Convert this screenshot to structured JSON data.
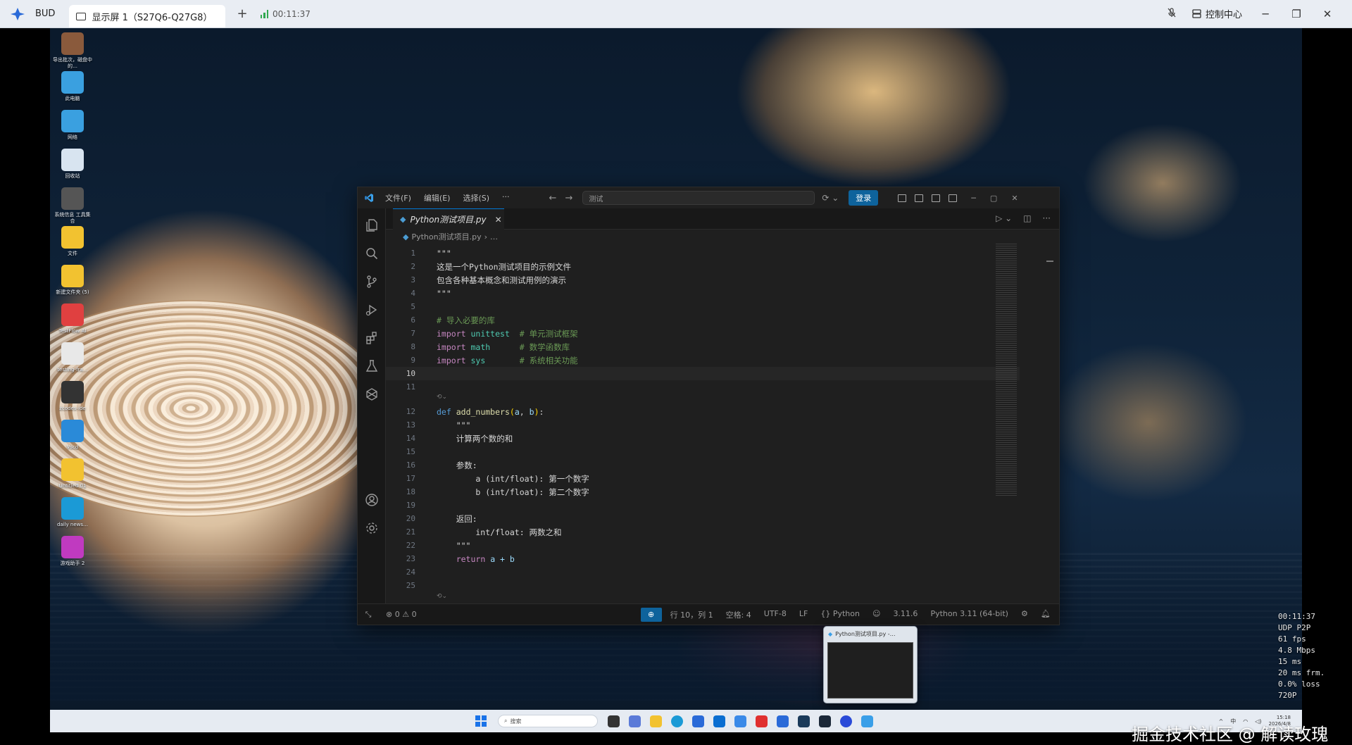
{
  "client": {
    "app_name": "BUD",
    "tab_title": "显示屏 1（S27Q6-Q27G8）",
    "timer": "00:11:37",
    "control_center": "控制中心"
  },
  "desktop_icons": [
    {
      "label": "导出批次，磁盘中的…",
      "color": "#8a5a3c"
    },
    {
      "label": "此电脑",
      "color": "#3aa0e0"
    },
    {
      "label": "网络",
      "color": "#3aa0e0"
    },
    {
      "label": "回收站",
      "color": "#d8e4f0"
    },
    {
      "label": "系统信息 工具集合",
      "color": "#555555"
    },
    {
      "label": "文件",
      "color": "#f2c230"
    },
    {
      "label": "新建文件夹 (5)",
      "color": "#f2c230"
    },
    {
      "label": "TestFlow AI",
      "color": "#e04040"
    },
    {
      "label": "testing-fra…",
      "color": "#e8e8e8"
    },
    {
      "label": "zcodes-ide",
      "color": "#333333"
    },
    {
      "label": "Vscd",
      "color": "#2a8ad8"
    },
    {
      "label": "Untitled 01",
      "color": "#f2c230"
    },
    {
      "label": "daily news…",
      "color": "#1b9ad6"
    },
    {
      "label": "游戏助手 2",
      "color": "#c03ac0"
    }
  ],
  "vscode": {
    "menu": [
      "文件(F)",
      "编辑(E)",
      "选择(S)",
      "···"
    ],
    "command_center": "测试",
    "login_label": "登录",
    "tab_label": "Python测试项目.py",
    "breadcrumb": "Python测试项目.py",
    "breadcrumb_more": "…",
    "lines": [
      {
        "n": "1",
        "text": "\"\"\""
      },
      {
        "n": "2",
        "text": "这是一个Python测试项目的示例文件"
      },
      {
        "n": "3",
        "text": "包含各种基本概念和测试用例的演示"
      },
      {
        "n": "4",
        "text": "\"\"\""
      },
      {
        "n": "5",
        "text": ""
      },
      {
        "n": "6",
        "text": "# 导入必要的库"
      },
      {
        "n": "7",
        "kw": "import",
        "mod": "unittest",
        "pad": "  ",
        "cm": "# 单元测试框架"
      },
      {
        "n": "8",
        "kw": "import",
        "mod": "math",
        "pad": "      ",
        "cm": "# 数学函数库"
      },
      {
        "n": "9",
        "kw": "import",
        "mod": "sys",
        "pad": "       ",
        "cm": "# 系统相关功能"
      },
      {
        "n": "10",
        "text": ""
      },
      {
        "n": "11",
        "text": ""
      },
      {
        "n": "12",
        "def": "def",
        "fn": "add_numbers",
        "p1": "a",
        "p2": "b"
      },
      {
        "n": "13",
        "text": "    \"\"\""
      },
      {
        "n": "14",
        "text": "    计算两个数的和"
      },
      {
        "n": "15",
        "text": ""
      },
      {
        "n": "16",
        "text": "    参数:"
      },
      {
        "n": "17",
        "text": "        a (int/float): 第一个数字"
      },
      {
        "n": "18",
        "text": "        b (int/float): 第二个数字"
      },
      {
        "n": "19",
        "text": ""
      },
      {
        "n": "20",
        "text": "    返回:"
      },
      {
        "n": "21",
        "text": "        int/float: 两数之和"
      },
      {
        "n": "22",
        "text": "    \"\"\""
      },
      {
        "n": "23",
        "ret": "return",
        "expr": "a + b"
      },
      {
        "n": "24",
        "text": ""
      },
      {
        "n": "25",
        "text": ""
      }
    ],
    "status": {
      "problems": "⊗ 0 ⚠ 0",
      "position": "行 10，列 1",
      "spaces": "空格: 4",
      "encoding": "UTF-8",
      "eol": "LF",
      "language": "Python",
      "version": "3.11.6",
      "interpreter": "Python 3.11 (64-bit)"
    }
  },
  "preview": {
    "title": "Python测试项目.py -…"
  },
  "taskbar": {
    "search_placeholder": "搜索",
    "ime": "中",
    "time": "15:18",
    "date": "2026/4/8"
  },
  "stats": [
    "00:11:37",
    "UDP P2P",
    "61 fps",
    "4.8 Mbps",
    "15 ms",
    "20 ms frm.",
    "0.0% loss",
    "720P"
  ],
  "watermark": "掘金技术社区 @ 解读玫瑰",
  "colors": {
    "accent": "#0e639c",
    "tab_border": "#0078d4",
    "keyword": "#c586c0",
    "module": "#4ec9b0",
    "comment": "#6a9955"
  }
}
